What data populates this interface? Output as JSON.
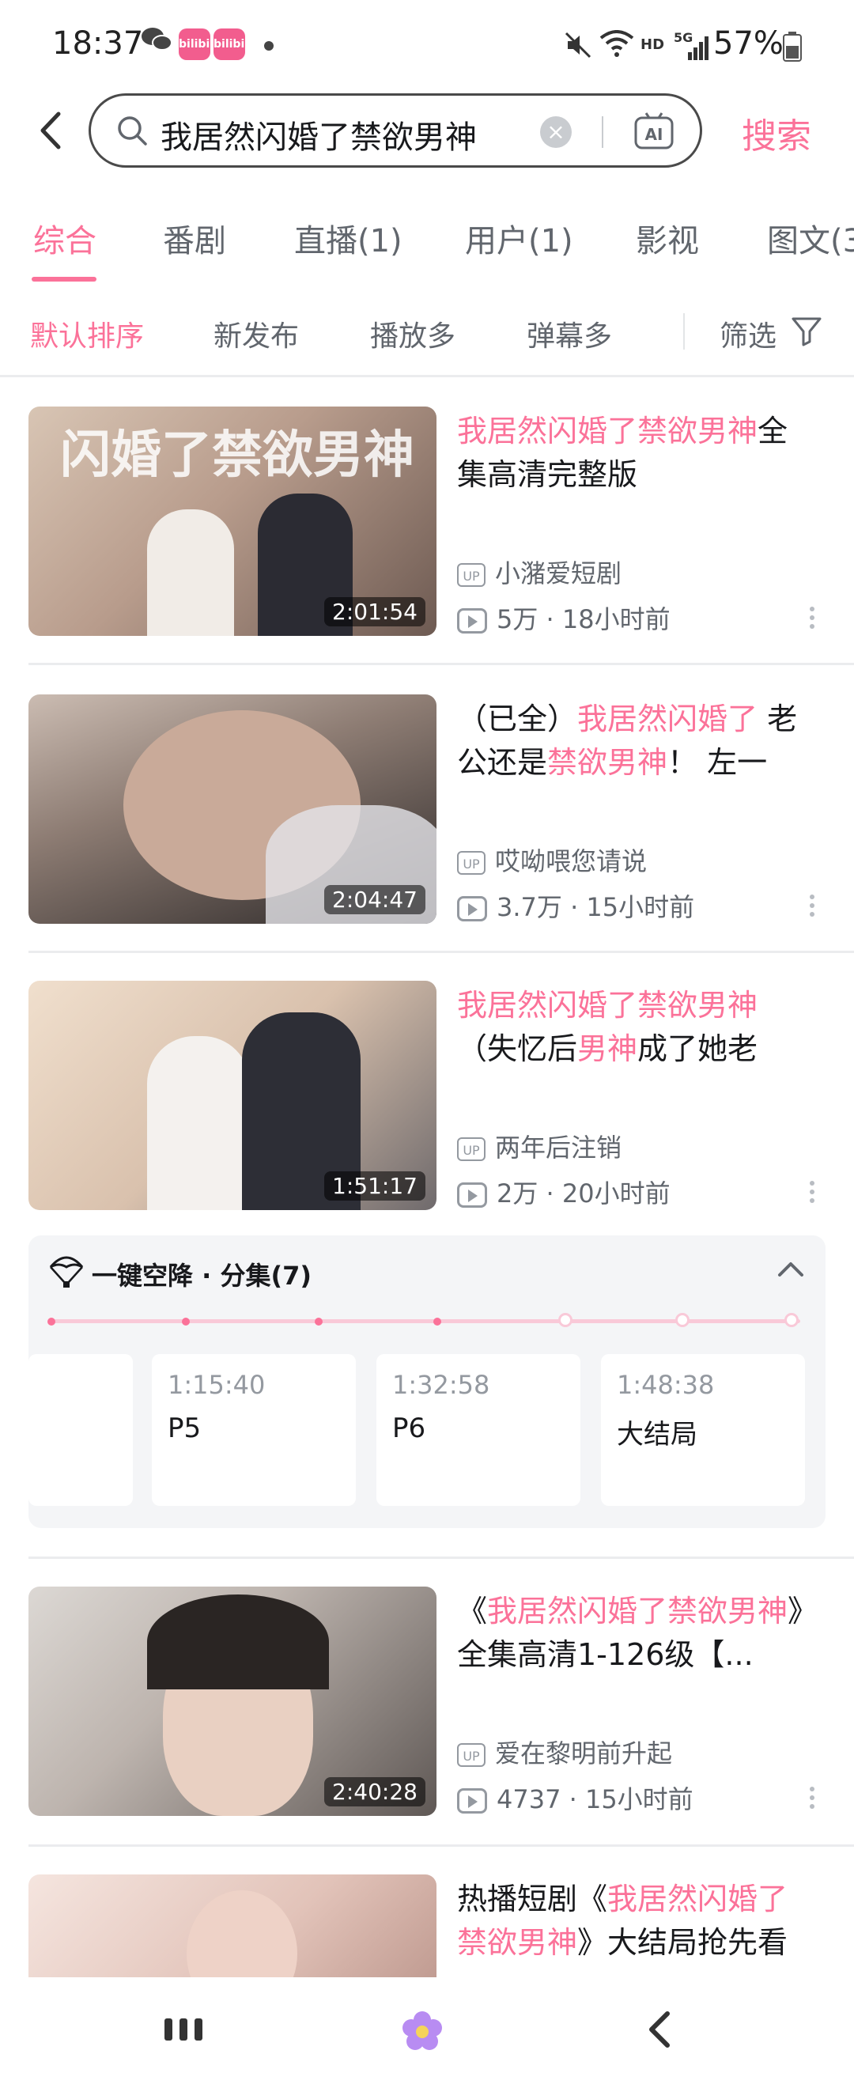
{
  "status": {
    "time": "18:37",
    "battery": "57%",
    "network_label": "5G",
    "hd_label": "HD",
    "app_badge": "bilibili"
  },
  "search": {
    "query": "我居然闪婚了禁欲男神",
    "button_label": "搜索",
    "ai_label": "AI"
  },
  "tabs": [
    "综合",
    "番剧",
    "直播(1)",
    "用户(1)",
    "影视",
    "图文(3"
  ],
  "sort": {
    "options": [
      "默认排序",
      "新发布",
      "播放多",
      "弹幕多"
    ],
    "filter_label": "筛选"
  },
  "results": [
    {
      "title_parts": [
        {
          "text": "我居然闪婚了禁欲男神",
          "hl": true
        },
        {
          "text": "全集高清完整版",
          "hl": false
        }
      ],
      "uploader": "小潴爱短剧",
      "views": "5万 · 18小时前",
      "duration": "2:01:54",
      "thumb_colors": [
        "#c9b6a6",
        "#7a5f55"
      ]
    },
    {
      "title_parts": [
        {
          "text": "（已全）",
          "hl": false
        },
        {
          "text": "我居然闪婚了",
          "hl": true
        },
        {
          "text": " 老公还是",
          "hl": false
        },
        {
          "text": "禁欲男神",
          "hl": true
        },
        {
          "text": "！  左一",
          "hl": false
        }
      ],
      "uploader": "哎呦喂您请说",
      "views": "3.7万 · 15小时前",
      "duration": "2:04:47",
      "thumb_colors": [
        "#b7a89d",
        "#2a2526"
      ]
    },
    {
      "title_parts": [
        {
          "text": "我居然闪婚了禁欲男神",
          "hl": true
        },
        {
          "text": "（失忆后",
          "hl": false
        },
        {
          "text": "男神",
          "hl": true
        },
        {
          "text": "成了她老公...",
          "hl": false
        }
      ],
      "uploader": "两年后注销",
      "views": "2万 · 20小时前",
      "duration": "1:51:17",
      "thumb_colors": [
        "#e6d3c2",
        "#3b3a3c"
      ]
    },
    {
      "title_parts": [
        {
          "text": "《",
          "hl": false
        },
        {
          "text": "我居然闪婚了禁欲男神",
          "hl": true
        },
        {
          "text": "》全集高清1-126级【...",
          "hl": false
        }
      ],
      "uploader": "爱在黎明前升起",
      "views": "4737 · 15小时前",
      "duration": "2:40:28",
      "thumb_colors": [
        "#d8d4d0",
        "#4f4a48"
      ]
    },
    {
      "title_parts": [
        {
          "text": "热播短剧《",
          "hl": false
        },
        {
          "text": "我居然闪婚了禁欲男神",
          "hl": true
        },
        {
          "text": "》大结局抢先看",
          "hl": false
        }
      ],
      "thumb_colors": [
        "#f1dcd6",
        "#c7a79e"
      ]
    }
  ],
  "episodes": {
    "title": "一键空降 · 分集(7)",
    "items": [
      {
        "time": "1:15:40",
        "label": "P5"
      },
      {
        "time": "1:32:58",
        "label": "P6"
      },
      {
        "time": "1:48:38",
        "label": "大结局"
      }
    ]
  }
}
